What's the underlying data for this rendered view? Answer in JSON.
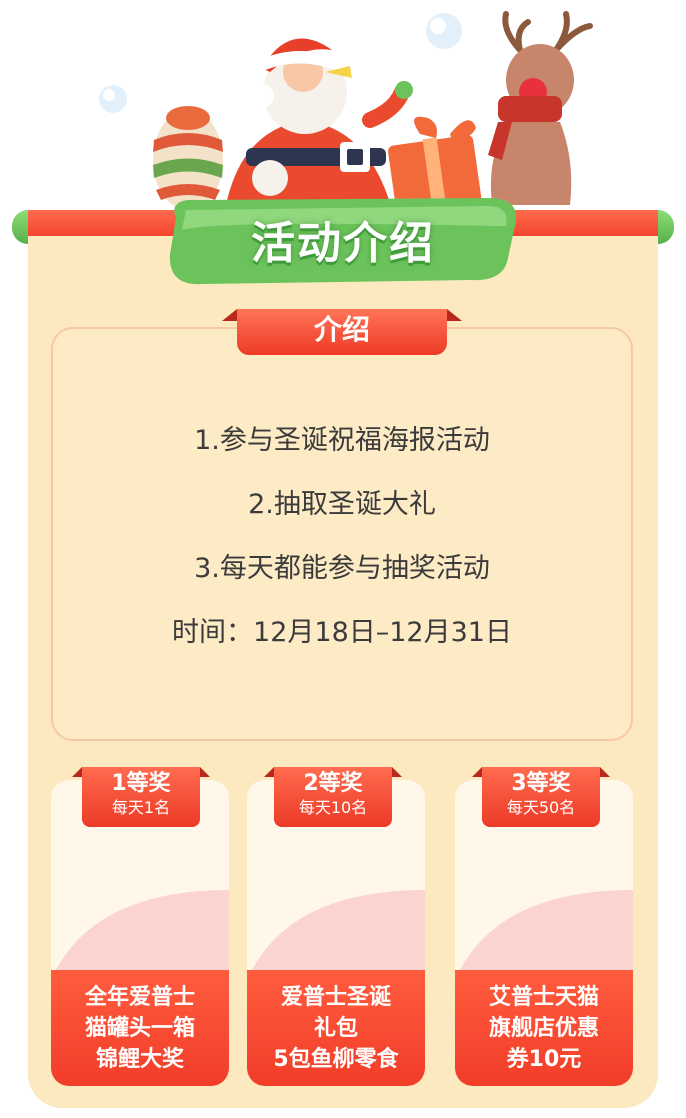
{
  "header": {
    "title": "活动介绍"
  },
  "intro": {
    "tab_label": "介绍",
    "lines": [
      "1.参与圣诞祝福海报活动",
      "2.抽取圣诞大礼",
      "3.每天都能参与抽奖活动",
      "时间：12月18日–12月31日"
    ]
  },
  "prizes": [
    {
      "rank": "1等奖",
      "quota": "每天1名",
      "name_lines": [
        "全年爱普士",
        "猫罐头一箱",
        "锦鲤大奖"
      ]
    },
    {
      "rank": "2等奖",
      "quota": "每天10名",
      "name_lines": [
        "爱普士圣诞",
        "礼包",
        "5包鱼柳零食"
      ]
    },
    {
      "rank": "3等奖",
      "quota": "每天50名",
      "name_lines": [
        "艾普士天猫",
        "旗舰店优惠",
        "券10元"
      ]
    }
  ],
  "colors": {
    "accent_red": "#ef3b25",
    "board_cream": "#fde9c0",
    "title_green": "#6cc35b",
    "text_dark": "#3b3b3b"
  },
  "icons": [
    "santa-icon",
    "reindeer-icon",
    "gift-box-icon",
    "striped-egg-icon",
    "snowflake-icon"
  ]
}
